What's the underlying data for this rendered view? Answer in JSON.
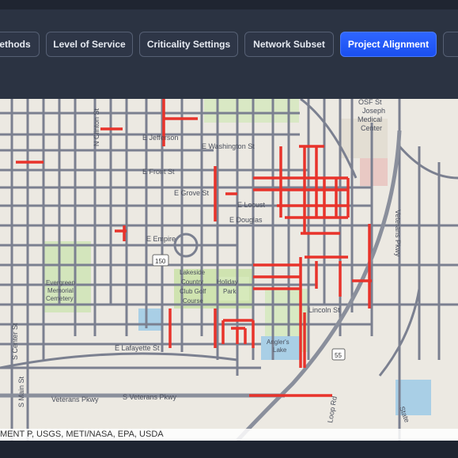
{
  "toolbar": {
    "tabs": [
      {
        "label": "ethods",
        "active": false
      },
      {
        "label": "Level of Service",
        "active": false
      },
      {
        "label": "Criticality Settings",
        "active": false
      },
      {
        "label": "Network Subset",
        "active": false
      },
      {
        "label": "Project Alignment",
        "active": true
      },
      {
        "label": "",
        "active": false
      }
    ]
  },
  "map": {
    "labels": {
      "osf": [
        "OSF St",
        "Joseph",
        "Medical",
        "Center"
      ],
      "washington": "E Washington St",
      "jefferson": "E Jefferson",
      "grove": "E Grove St",
      "locust": "E Locust",
      "douglas": "E Douglas",
      "front": "E Front St",
      "empire": "E Empire",
      "lincoln": "Lincoln St",
      "lafayette": "E Lafayette St",
      "evergreen": [
        "Evergreen",
        "Memorial",
        "Cemetery"
      ],
      "lakeside": [
        "Lakeside",
        "Country",
        "Club Golf",
        "Course"
      ],
      "holiday": [
        "Holiday",
        "Park"
      ],
      "anglers": [
        "Angler's",
        "Lake"
      ],
      "veterans_s": "S Veterans Pkwy",
      "veterans_w": "Veterans Pkwy",
      "veterans_n": "Veterans Pkwy",
      "mainst": "S Main St",
      "centerst": "S Center St",
      "clinton": "N Clinton St",
      "looprd": "Loop Rd",
      "stateh": "State",
      "route150": "150",
      "route55": "55"
    },
    "colors": {
      "project": "#e8332b",
      "roads": "#7b8090",
      "park": "#cfe3b0",
      "water": "#a9cfe6",
      "highway": "#8a8f9c"
    }
  },
  "attribution": "MENT P, USGS, METI/NASA, EPA, USDA"
}
